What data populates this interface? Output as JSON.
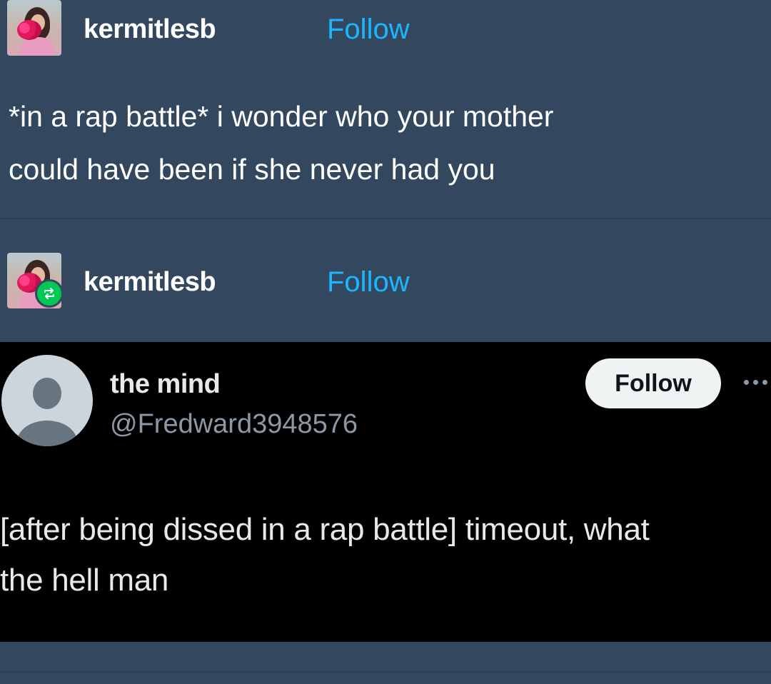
{
  "original_post": {
    "username": "kermitlesb",
    "follow_label": "Follow",
    "text_line_1": "*in a rap battle* i wonder who your mother",
    "text_line_2": "could have been if she never had you"
  },
  "reblog_post": {
    "username": "kermitlesb",
    "follow_label": "Follow",
    "badge_icon": "reblog-icon"
  },
  "tweet": {
    "display_name": "the mind",
    "handle": "@Fredward3948576",
    "follow_label": "Follow",
    "more_icon": "more-horizontal-icon",
    "text_line_1": "[after being dissed in a rap battle] timeout, what",
    "text_line_2": "the hell man"
  },
  "colors": {
    "tumblr_background": "#33475f",
    "follow_link": "#1cb6ff",
    "tweet_background": "#000000",
    "reblog_badge": "#00c853"
  }
}
